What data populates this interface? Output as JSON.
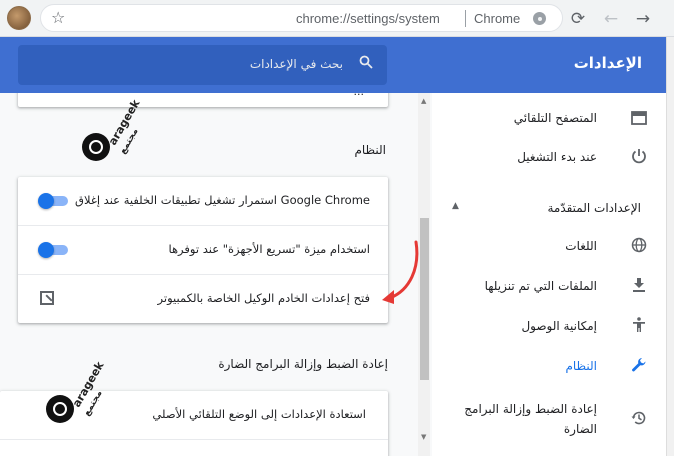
{
  "browser": {
    "url": "chrome://settings/system",
    "name": "Chrome",
    "icons": [
      "star-icon",
      "reload-icon",
      "back-icon",
      "forward-icon",
      "chrome-logo-icon"
    ]
  },
  "header": {
    "title": "الإعدادات",
    "search_placeholder": "بحث في الإعدادات"
  },
  "sidebar": {
    "items": [
      {
        "label": "المتصفح التلقائي",
        "icon": "browser-icon"
      },
      {
        "label": "عند بدء التشغيل",
        "icon": "power-icon"
      },
      {
        "label": "اللغات",
        "icon": "globe-icon"
      },
      {
        "label": "الملفات التي تم تنزيلها",
        "icon": "download-icon"
      },
      {
        "label": "إمكانية الوصول",
        "icon": "accessibility-icon"
      },
      {
        "label": "النظام",
        "icon": "wrench-icon",
        "active": true
      },
      {
        "label": "إعادة الضبط وإزالة البرامج",
        "label2": "الضارة",
        "icon": "history-icon"
      }
    ],
    "advanced_heading": "الإعدادات المتقدّمة"
  },
  "main": {
    "top_card_text": "...",
    "system_heading": "النظام",
    "system_rows": [
      {
        "label": "استمرار تشغيل تطبيقات الخلفية عند إغلاق Google Chrome",
        "control": "toggle",
        "on": true
      },
      {
        "label": "استخدام ميزة \"تسريع الأجهزة\" عند توفرها",
        "control": "toggle",
        "on": true
      },
      {
        "label": "فتح إعدادات الخادم الوكيل الخاصة بالكمبيوتر",
        "control": "external-link"
      }
    ],
    "reset_heading": "إعادة الضبط وإزالة البرامج الضارة",
    "reset_rows": [
      {
        "label": "استعادة الإعدادات إلى الوضع التلقائي الأصلي"
      }
    ]
  },
  "watermark": {
    "latin": "arageek",
    "arabic": "مجتمع"
  },
  "colors": {
    "header_blue": "#3f6fd1",
    "search_blue": "#3160bd",
    "accent": "#1a73e8",
    "annotation_red": "#e53935"
  }
}
